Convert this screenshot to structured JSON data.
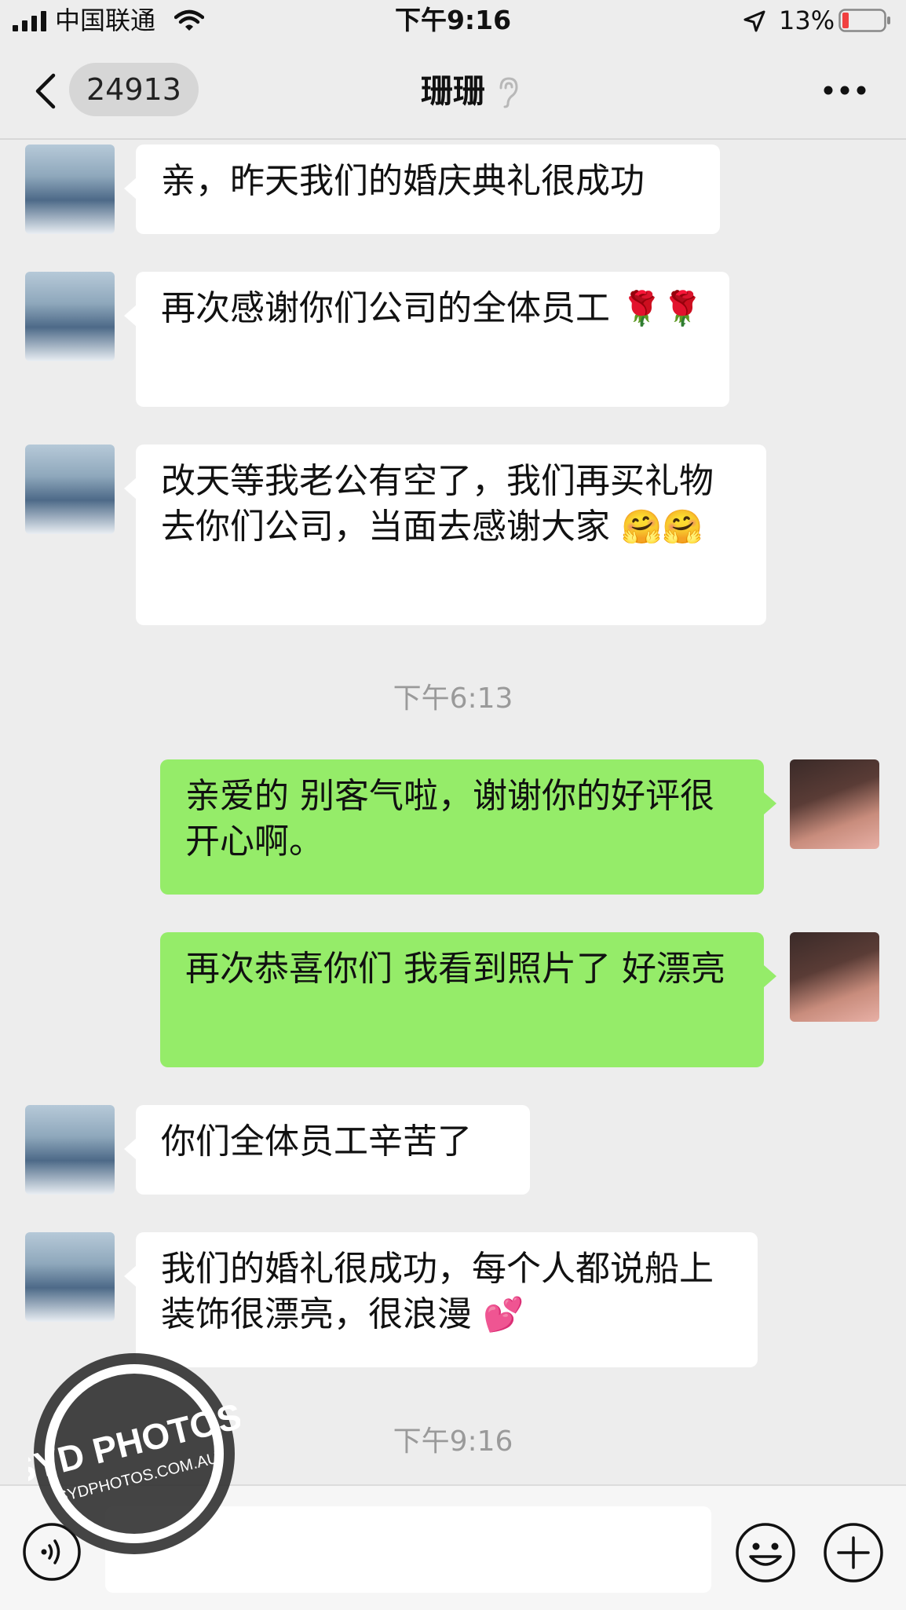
{
  "status_bar": {
    "carrier": "中国联通",
    "time": "下午9:16",
    "battery_text": "13%"
  },
  "nav": {
    "back_count": "24913",
    "title": "珊珊"
  },
  "messages": [
    {
      "side": "in",
      "text": "亲，昨天我们的婚庆典礼很成功",
      "emoji": ""
    },
    {
      "side": "in",
      "text": "再次感谢你们公司的全体员工",
      "emoji": "🌹🌹"
    },
    {
      "side": "in",
      "text": "改天等我老公有空了，我们再买礼物去你们公司，当面去感谢大家",
      "emoji": "🤗🤗"
    },
    {
      "side": "out",
      "text": "亲爱的 别客气啦，谢谢你的好评很开心啊。",
      "emoji": ""
    },
    {
      "side": "out",
      "text": "再次恭喜你们 我看到照片了 好漂亮",
      "emoji": ""
    },
    {
      "side": "in",
      "text": "你们全体员工辛苦了",
      "emoji": ""
    },
    {
      "side": "in",
      "text": "我们的婚礼很成功，每个人都说船上装饰很漂亮，很浪漫",
      "emoji": "💕"
    }
  ],
  "timestamps": [
    "下午6:13",
    "下午9:16"
  ],
  "watermark": {
    "line1": "SYD PHOTOS",
    "line2": "SYDPHOTOS.COM.AU"
  },
  "input": {
    "value": "",
    "placeholder": ""
  },
  "colors": {
    "outgoing_bubble": "#95ec69",
    "incoming_bubble": "#ffffff",
    "background": "#ededed"
  }
}
